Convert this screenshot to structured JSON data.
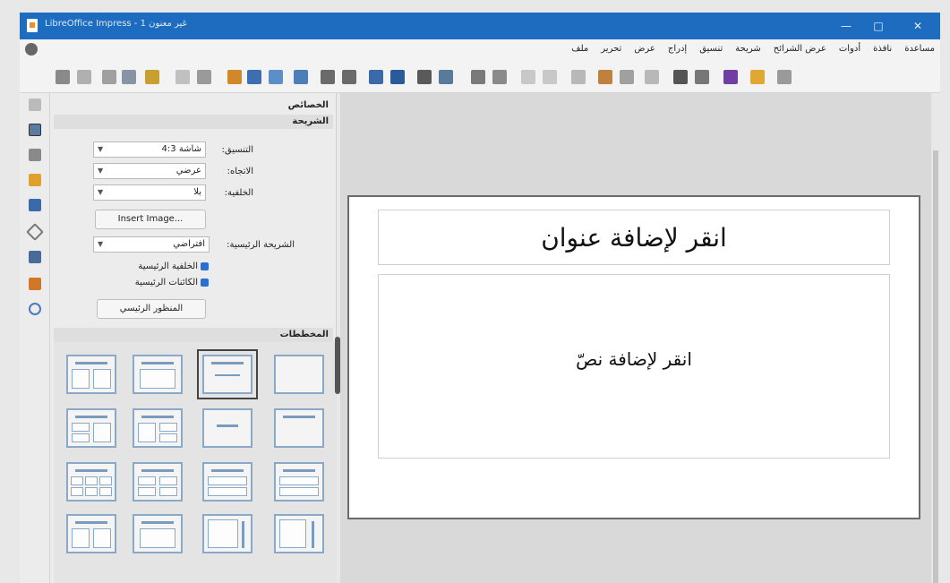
{
  "window": {
    "title": "LibreOffice Impress - غير معنون 1",
    "controls": {
      "minimize": "—",
      "maximize": "□",
      "close": "✕"
    }
  },
  "menubar": {
    "items": [
      "ملف",
      "تحرير",
      "عرض",
      "إدراج",
      "تنسيق",
      "شريحة",
      "عرض الشرائح",
      "أدوات",
      "نافذة",
      "مساعدة"
    ]
  },
  "sidebar": {
    "properties_heading": "الخصائص",
    "slide_section": "الشريحة",
    "format_label": "التنسيق:",
    "format_value": "شاشة 4:3",
    "orientation_label": "الاتجاه:",
    "orientation_value": "عرضي",
    "background_label": "الخلفية:",
    "background_value": "بلا",
    "insert_image_button": "Insert Image...",
    "master_slide_label": "الشريحة الرئيسية:",
    "master_slide_value": "افتراضي",
    "master_background_check": "الخلفية الرئيسية",
    "master_objects_check": "الكائنات الرئيسية",
    "master_view_button": "المنظور الرئيسي",
    "layouts_heading": "المخططات",
    "layout_count": 16,
    "selected_layout_index": 1
  },
  "slide": {
    "title_placeholder": "انقر لإضافة عنوان",
    "body_placeholder": "انقر لإضافة نصّ"
  },
  "colors": {
    "titlebar": "#1e6cc0",
    "accent": "#2a6fd0",
    "layout_border": "#8aa9c9"
  }
}
